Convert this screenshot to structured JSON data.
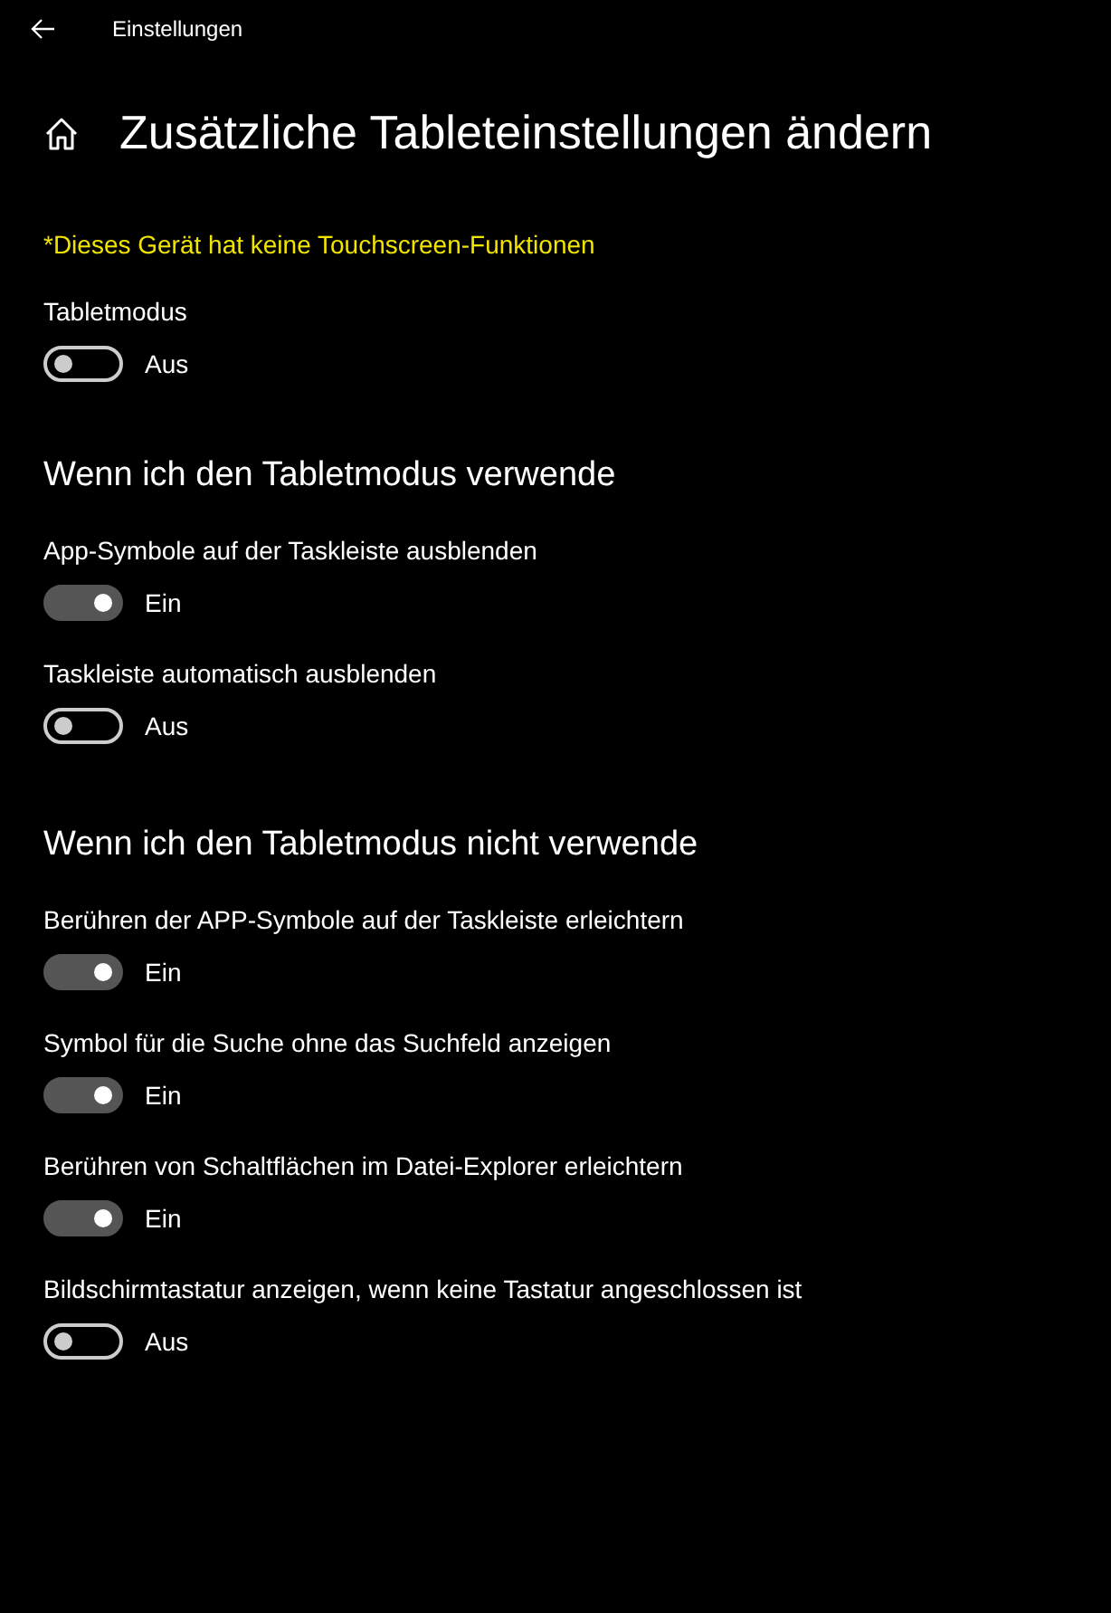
{
  "header": {
    "title": "Einstellungen"
  },
  "page_title": "Zusätzliche Tableteinstellungen ändern",
  "notice": "*Dieses Gerät hat keine Touchscreen-Funktionen",
  "settings": [
    {
      "label": "Tabletmodus",
      "on": false,
      "state_text": "Aus"
    }
  ],
  "sections": [
    {
      "heading": "Wenn ich den Tabletmodus verwende",
      "settings": [
        {
          "label": "App-Symbole auf der Taskleiste ausblenden",
          "on": true,
          "state_text": "Ein"
        },
        {
          "label": "Taskleiste automatisch ausblenden",
          "on": false,
          "state_text": "Aus"
        }
      ]
    },
    {
      "heading": "Wenn ich den Tabletmodus nicht verwende",
      "settings": [
        {
          "label": "Berühren der APP-Symbole auf der Taskleiste erleichtern",
          "on": true,
          "state_text": "Ein"
        },
        {
          "label": "Symbol für die Suche ohne das Suchfeld anzeigen",
          "on": true,
          "state_text": "Ein"
        },
        {
          "label": "Berühren von Schaltflächen im Datei-Explorer erleichtern",
          "on": true,
          "state_text": "Ein"
        },
        {
          "label": "Bildschirmtastatur anzeigen, wenn keine Tastatur angeschlossen ist",
          "on": false,
          "state_text": "Aus"
        }
      ]
    }
  ]
}
